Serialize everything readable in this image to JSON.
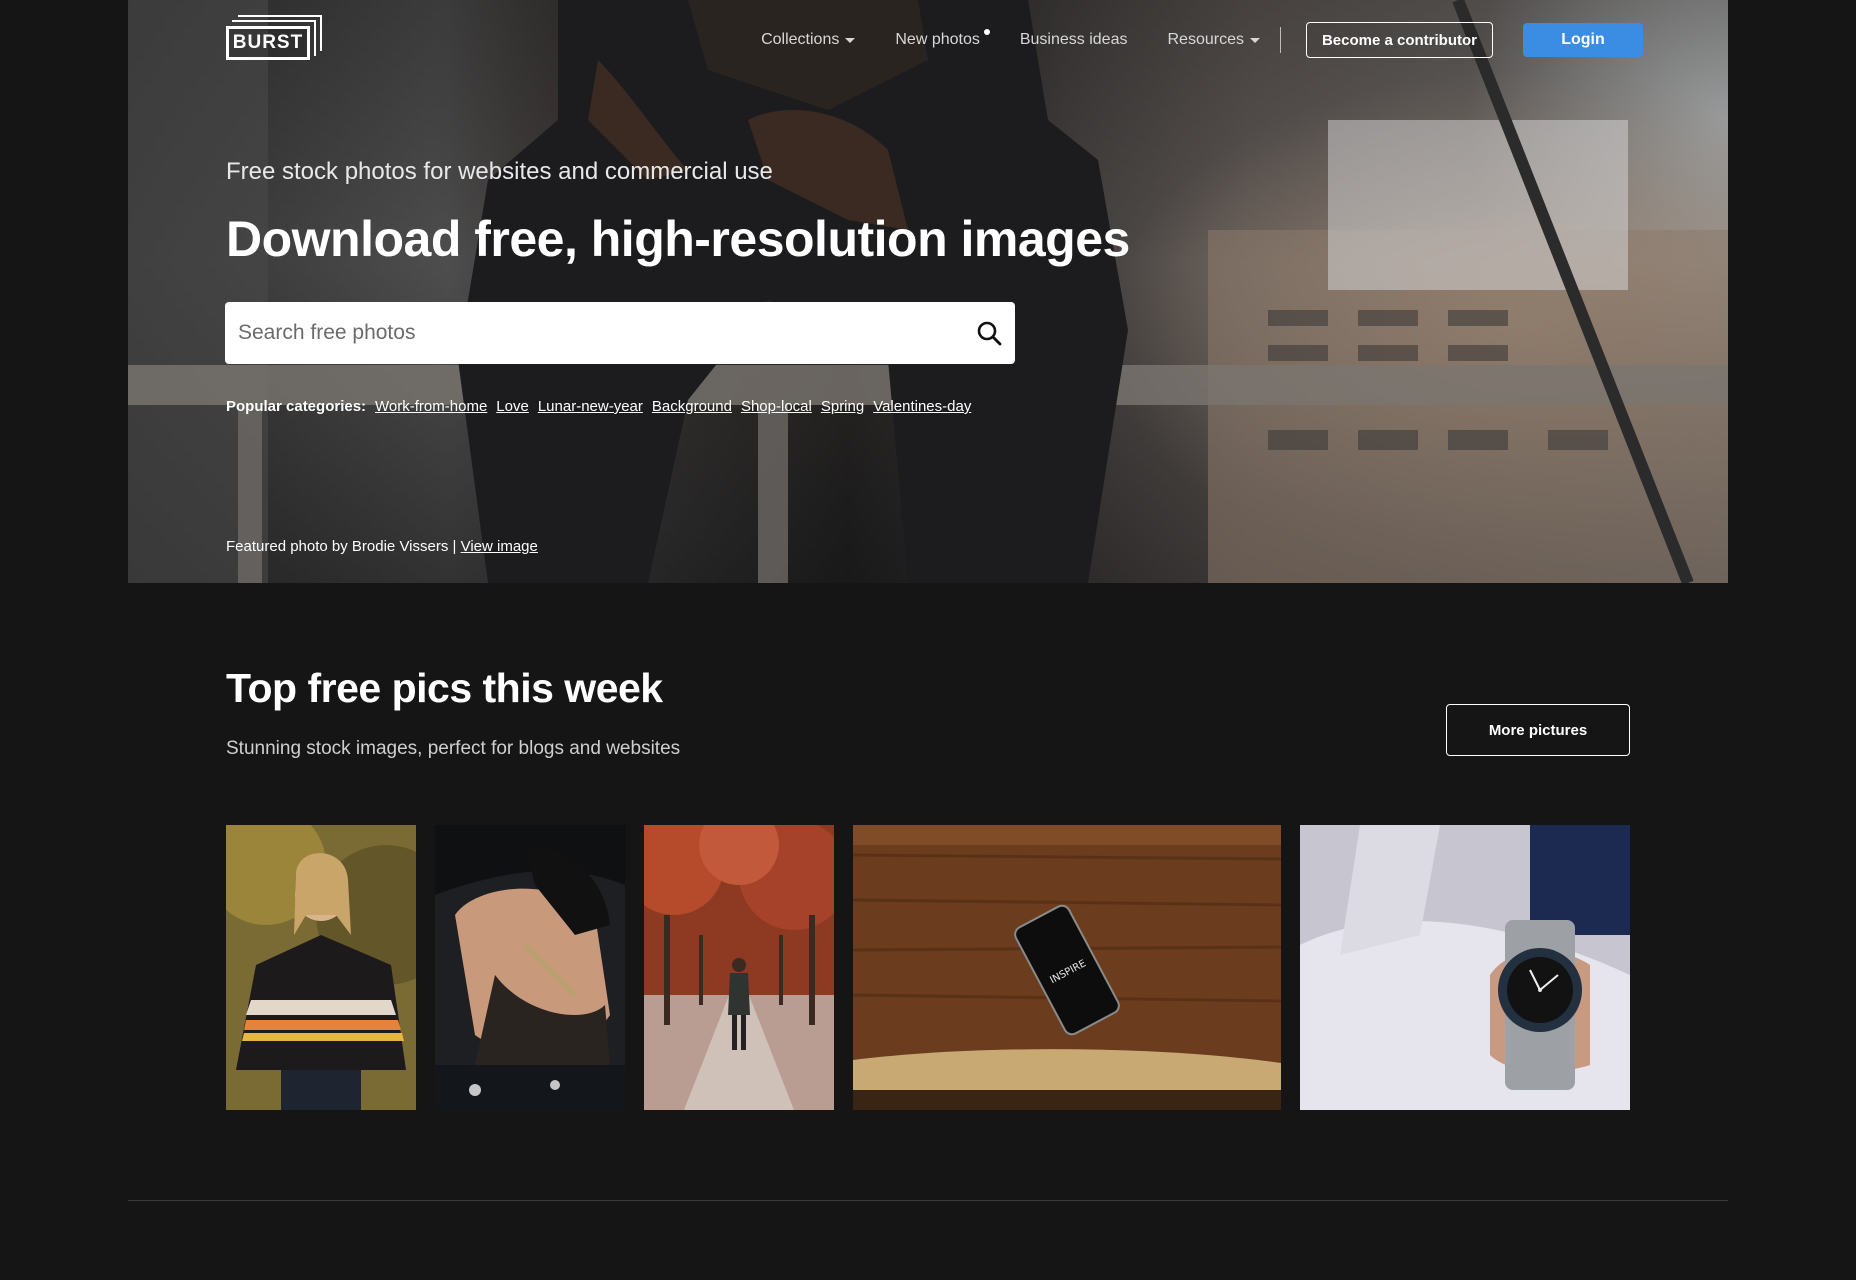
{
  "brand": {
    "logo_text": "BURST"
  },
  "nav": {
    "items": [
      {
        "label": "Collections",
        "has_caret": true
      },
      {
        "label": "New photos",
        "has_dot": true
      },
      {
        "label": "Business ideas"
      },
      {
        "label": "Resources",
        "has_caret": true
      }
    ],
    "contributor_label": "Become a contributor",
    "login_label": "Login"
  },
  "hero": {
    "subtitle": "Free stock photos for websites and commercial use",
    "title": "Download free, high-resolution images",
    "search": {
      "placeholder": "Search free photos",
      "value": ""
    },
    "popular_label": "Popular categories:",
    "categories": [
      "Work-from-home",
      "Love",
      "Lunar-new-year",
      "Background",
      "Shop-local",
      "Spring",
      "Valentines-day"
    ],
    "featured_prefix": "Featured photo by Brodie Vissers |",
    "featured_link": "View image"
  },
  "section": {
    "title": "Top free pics this week",
    "subtitle": "Stunning stock images, perfect for blogs and websites",
    "more_label": "More pictures"
  },
  "photos": [
    {
      "subject": "woman in striped poncho"
    },
    {
      "subject": "barber trimming beard"
    },
    {
      "subject": "woman on autumn path"
    },
    {
      "subject": "phone on wooden table",
      "phone_text": "INSPIRE"
    },
    {
      "subject": "wristwatch on arm"
    }
  ],
  "colors": {
    "background": "#151515",
    "login": "#3b8ce3",
    "text": "#ffffff"
  }
}
